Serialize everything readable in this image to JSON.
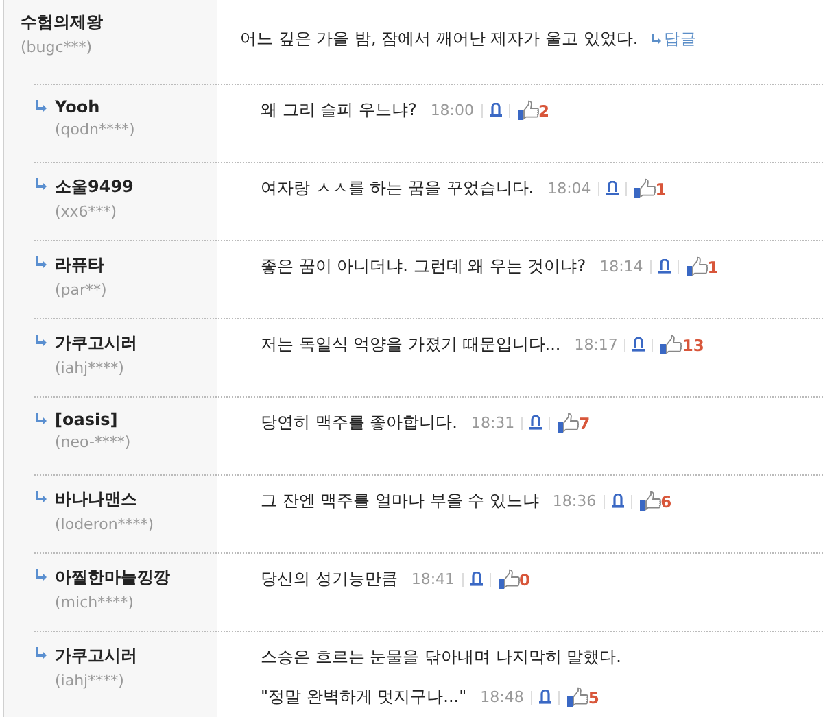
{
  "post": {
    "author": "수험의제왕",
    "user_id": "(bugc***)",
    "text": "어느 깊은 가을 밤, 잠에서 깨어난 제자가 울고 있었다.",
    "reply_link": "답글"
  },
  "replies": [
    {
      "author": "Yooh",
      "user_id": "(qodn****)",
      "lines": [
        "왜 그리 슬피 우느냐?"
      ],
      "time": "18:00",
      "likes": "2"
    },
    {
      "author": "소울9499",
      "user_id": "(xx6***)",
      "lines": [
        "여자랑 ㅅㅅ를 하는 꿈을 꾸었습니다."
      ],
      "time": "18:04",
      "likes": "1"
    },
    {
      "author": "라퓨타",
      "user_id": "(par**)",
      "lines": [
        "좋은 꿈이 아니더냐. 그런데 왜 우는 것이냐?"
      ],
      "time": "18:14",
      "likes": "1"
    },
    {
      "author": "가쿠고시러",
      "user_id": "(iahj****)",
      "lines": [
        "저는 독일식 억양을 가졌기 때문입니다..."
      ],
      "time": "18:17",
      "likes": "13"
    },
    {
      "author": "[oasis]",
      "user_id": "(neo-****)",
      "lines": [
        "당연히 맥주를 좋아합니다."
      ],
      "time": "18:31",
      "likes": "7"
    },
    {
      "author": "바나나맨스",
      "user_id": "(loderon****)",
      "lines": [
        "그 잔엔 맥주를 얼마나 부을 수 있느냐"
      ],
      "time": "18:36",
      "likes": "6"
    },
    {
      "author": "아찔한마늘낑깡",
      "user_id": "(mich****)",
      "lines": [
        "당신의 성기능만큼"
      ],
      "time": "18:41",
      "likes": "0"
    },
    {
      "author": "가쿠고시러",
      "user_id": "(iahj****)",
      "lines": [
        "스승은 흐르는 눈물을 닦아내며 나지막히 말했다.",
        "\"정말 완벽하게 멋지구나...\""
      ],
      "time": "18:48",
      "likes": "5"
    }
  ]
}
